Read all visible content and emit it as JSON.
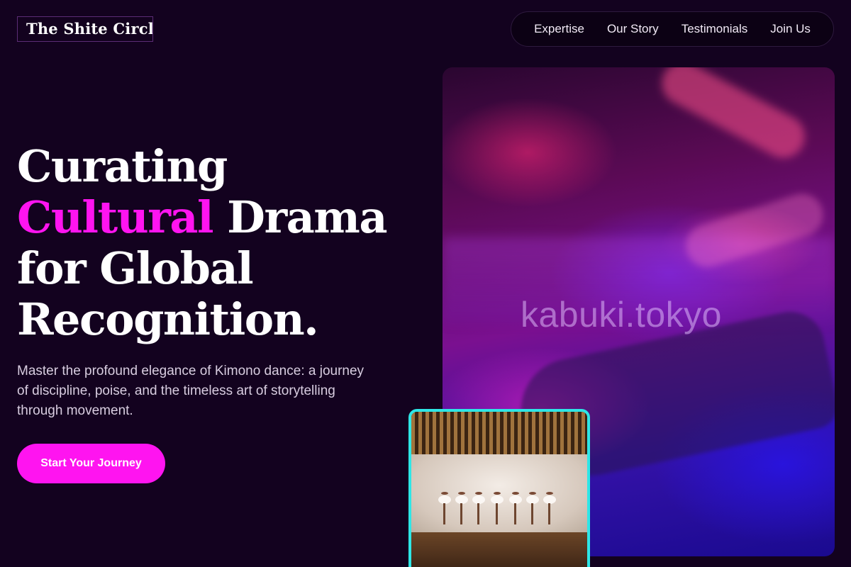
{
  "brand": {
    "name": "The Shite Circle"
  },
  "nav": {
    "items": [
      {
        "label": "Expertise"
      },
      {
        "label": "Our Story"
      },
      {
        "label": "Testimonials"
      },
      {
        "label": "Join Us"
      }
    ]
  },
  "hero": {
    "headline": {
      "line1": "Curating",
      "accent": "Cultural",
      "after_accent": " Drama",
      "line3": "for Global",
      "line4": "Recognition."
    },
    "subtext": "Master the profound elegance of Kimono dance: a journey of discipline, poise, and the timeless art of storytelling through movement.",
    "cta_label": "Start Your Journey",
    "image_watermark": "kabuki.tokyo"
  },
  "colors": {
    "background": "#13021f",
    "accent": "#ff14f0",
    "inset_border": "#2ee6e6",
    "subtext": "#d8cde0"
  }
}
